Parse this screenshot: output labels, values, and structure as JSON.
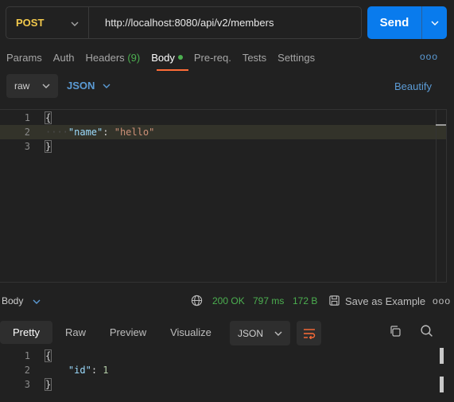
{
  "request": {
    "method": "POST",
    "url": "http://localhost:8080/api/v2/members",
    "send_label": "Send"
  },
  "tabs": {
    "params": "Params",
    "auth": "Auth",
    "headers": "Headers",
    "headers_count": "(9)",
    "body": "Body",
    "prereq": "Pre-req.",
    "tests": "Tests",
    "settings": "Settings",
    "more": "ooo"
  },
  "body_options": {
    "mode": "raw",
    "language": "JSON",
    "beautify": "Beautify"
  },
  "request_editor": {
    "line_numbers": [
      "1",
      "2",
      "3"
    ],
    "open_brace": "{",
    "key": "\"name\"",
    "colon": ": ",
    "value": "\"hello\"",
    "close_brace": "}"
  },
  "response": {
    "label": "Body",
    "status": "200 OK",
    "time": "797 ms",
    "size": "172 B",
    "save_label": "Save as Example",
    "more": "ooo",
    "tabs": {
      "pretty": "Pretty",
      "raw": "Raw",
      "preview": "Preview",
      "visualize": "Visualize"
    },
    "format": "JSON",
    "editor": {
      "line_numbers": [
        "1",
        "2",
        "3"
      ],
      "open_brace": "{",
      "key": "\"id\"",
      "colon": ": ",
      "value": "1",
      "close_brace": "}"
    }
  },
  "colors": {
    "background": "#212121",
    "method": "#f2c94c",
    "send": "#097bed",
    "accent_link": "#5b9bd5",
    "active_tab_underline": "#ff6c37",
    "success": "#4caf50"
  },
  "icons": {
    "method_dropdown": "chevron-down-icon",
    "send_dropdown": "chevron-down-icon",
    "network": "globe-icon",
    "save": "save-icon",
    "wrap": "wrap-lines-icon",
    "copy": "copy-icon",
    "search": "search-icon"
  }
}
